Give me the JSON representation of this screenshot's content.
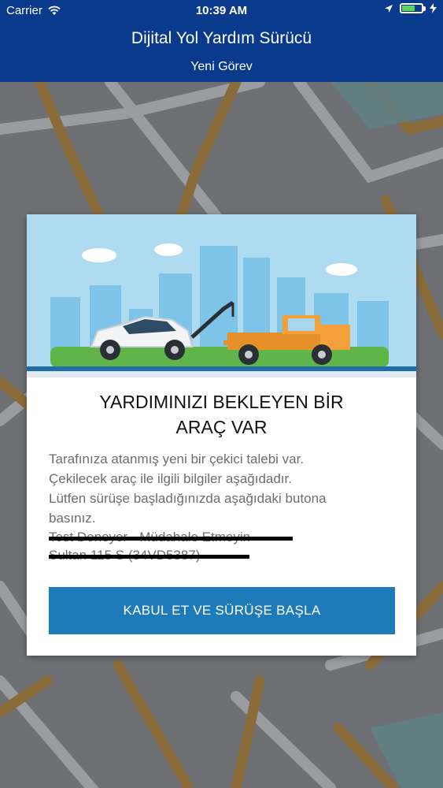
{
  "status_bar": {
    "carrier": "Carrier",
    "time": "10:39 AM",
    "icons": [
      "wifi-icon",
      "location-arrow-icon",
      "battery-icon",
      "charging-bolt-icon"
    ]
  },
  "nav": {
    "title": "Dijital Yol Yardım Sürücü",
    "subtitle": "Yeni Görev"
  },
  "dialog": {
    "illustration": "tow-truck-with-car-illustration",
    "heading_line1": "YARDIMINIZI BEKLEYEN BİR",
    "heading_line2": "ARAÇ VAR",
    "message_lines": [
      "Tarafınıza atanmış yeni bir çekici talebi var.",
      "Çekilecek araç ile ilgili bilgiler aşağıdadır.",
      "Lütfen sürüşe başladığınızda aşağıdaki butona",
      "basınız."
    ],
    "redacted_lines": [
      "Test Deneyer - Müdahale Etmeyin",
      "Sultan 115 S (34VD5387)"
    ],
    "accept_button": "KABUL ET VE SÜRÜŞE BAŞLA"
  },
  "colors": {
    "nav_bg": "#0a3a8c",
    "button_bg": "#1e7ab8",
    "map_bg": "#6e7073",
    "road_major": "#8a6c3a"
  }
}
